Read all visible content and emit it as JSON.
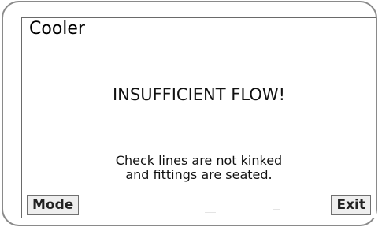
{
  "screen": {
    "title": "Cooler"
  },
  "alert": {
    "heading": "INSUFFICIENT FLOW!",
    "message_line1": "Check lines are not kinked",
    "message_line2": "and fittings are seated."
  },
  "buttons": {
    "mode_label": "Mode",
    "exit_label": "Exit"
  },
  "colors": {
    "background": "#ffffff",
    "text": "#000000",
    "button_fill": "#eeeeee",
    "border": "#707070"
  }
}
